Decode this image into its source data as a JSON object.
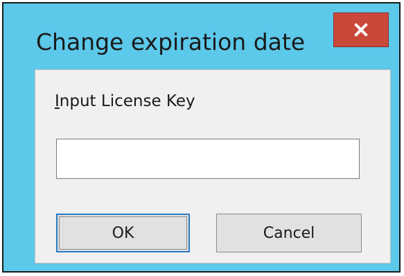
{
  "window": {
    "title": "Change expiration date",
    "close_icon": "close-icon",
    "colors": {
      "frame": "#5cc8ea",
      "close_button": "#c9483a",
      "client_area": "#f0f0f0",
      "default_button_border": "#2b78c4"
    }
  },
  "form": {
    "label_mnemonic": "I",
    "label_rest": "nput License Key",
    "input_value": "",
    "input_placeholder": ""
  },
  "buttons": {
    "ok_label": "OK",
    "cancel_label": "Cancel"
  }
}
